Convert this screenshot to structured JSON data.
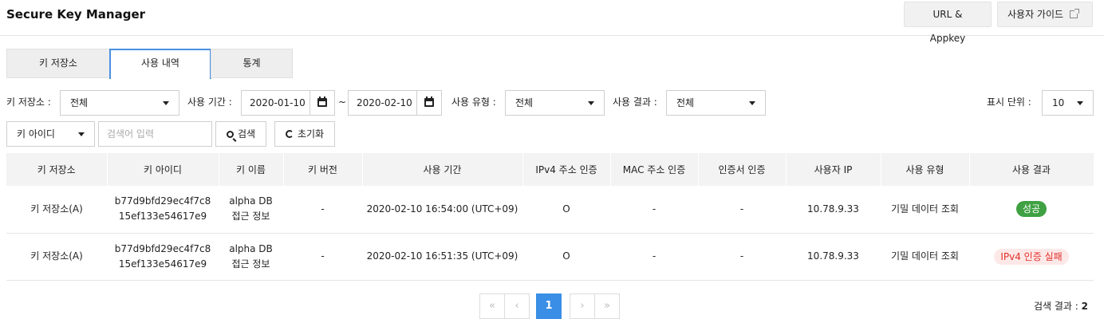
{
  "header": {
    "title": "Secure Key Manager",
    "url_appkey_label": "URL & Appkey",
    "user_guide_label": "사용자 가이드"
  },
  "tabs": [
    {
      "label": "키 저장소"
    },
    {
      "label": "사용 내역",
      "active": true
    },
    {
      "label": "통계"
    }
  ],
  "filters": {
    "keystore_label": "키 저장소 :",
    "keystore_value": "전체",
    "period_label": "사용 기간 :",
    "date_from": "2020-01-10",
    "date_sep": "~",
    "date_to": "2020-02-10",
    "usage_type_label": "사용 유형 :",
    "usage_type_value": "전체",
    "result_label": "사용 결과 :",
    "result_value": "전체",
    "page_size_label": "표시 단위 :",
    "page_size_value": "10"
  },
  "search": {
    "field_value": "키 아이디",
    "placeholder": "검색어 입력",
    "search_label": "검색",
    "reset_label": "초기화"
  },
  "table": {
    "columns": [
      "키 저장소",
      "키 아이디",
      "키 이름",
      "키 버전",
      "사용 기간",
      "IPv4 주소 인증",
      "MAC 주소 인증",
      "인증서 인증",
      "사용자 IP",
      "사용 유형",
      "사용 결과"
    ],
    "rows": [
      {
        "keystore": "키 저장소(A)",
        "key_id_1": "b77d9bfd29ec4f7c8",
        "key_id_2": "15ef133e54617e9",
        "key_name_1": "alpha DB",
        "key_name_2": "접근 정보",
        "version": "-",
        "period": "2020-02-10 16:54:00 (UTC+09)",
        "ipv4": "O",
        "mac": "-",
        "cert": "-",
        "user_ip": "10.78.9.33",
        "usage_type": "기밀 데이터 조회",
        "result": "성공"
      },
      {
        "keystore": "키 저장소(A)",
        "key_id_1": "b77d9bfd29ec4f7c8",
        "key_id_2": "15ef133e54617e9",
        "key_name_1": "alpha DB",
        "key_name_2": "접근 정보",
        "version": "-",
        "period": "2020-02-10 16:51:35 (UTC+09)",
        "ipv4": "O",
        "mac": "-",
        "cert": "-",
        "user_ip": "10.78.9.33",
        "usage_type": "기밀 데이터 조회",
        "result": "IPv4 인증 실패"
      }
    ]
  },
  "pagination": {
    "first": "«",
    "prev": "‹",
    "current": "1",
    "next": "›",
    "last": "»"
  },
  "result_count": {
    "label": "검색 결과 :",
    "value": "2"
  },
  "colors": {
    "accent": "#3a8ee6",
    "success": "#3fa142",
    "fail_text": "#e0302a",
    "fail_bg": "#fde8e8"
  }
}
